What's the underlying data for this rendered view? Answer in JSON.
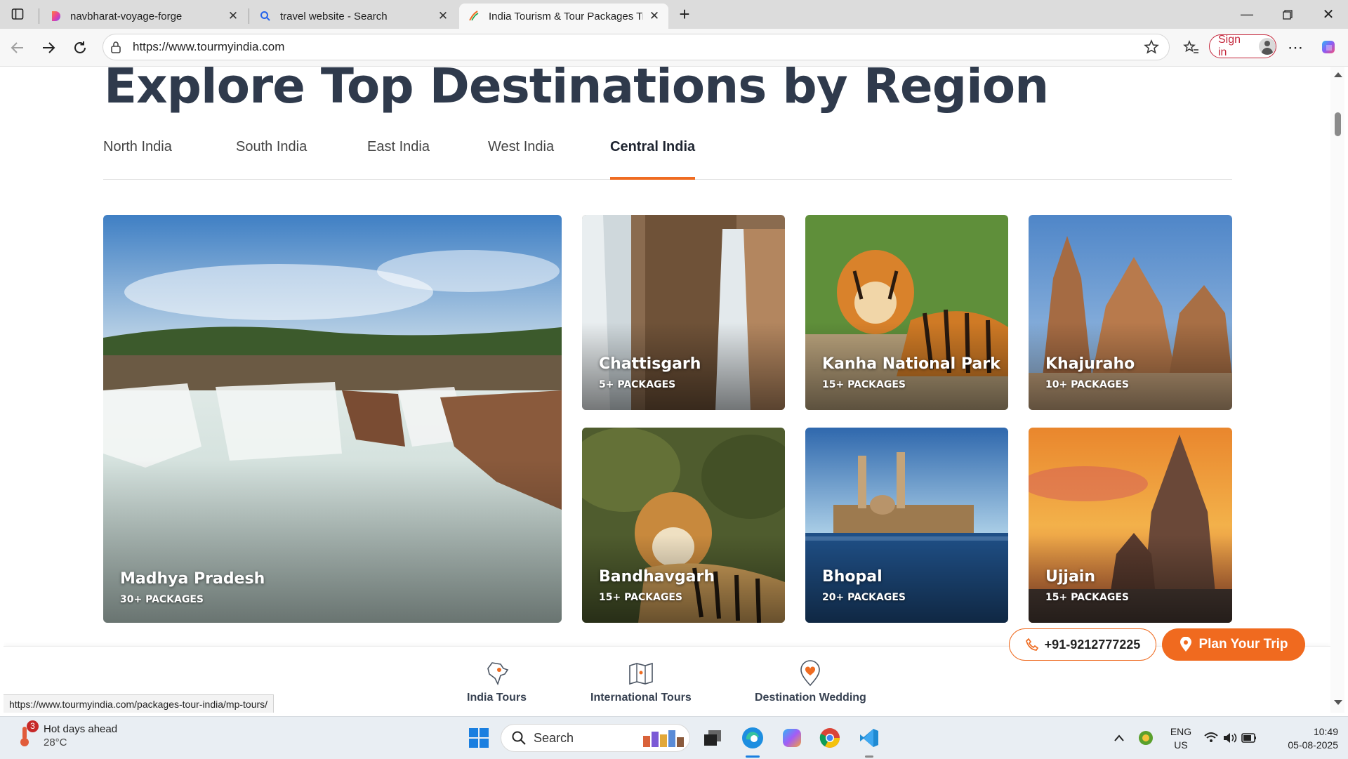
{
  "browser": {
    "tabs": [
      {
        "title": "navbharat-voyage-forge",
        "icon": "lovable-icon",
        "active": false
      },
      {
        "title": "travel website - Search",
        "icon": "search-icon",
        "active": false
      },
      {
        "title": "India Tourism & Tour Packages Tr",
        "icon": "tourmyindia-icon",
        "active": true
      }
    ],
    "url": "https://www.tourmyindia.com",
    "sign_in_label": "Sign in",
    "status_url": "https://www.tourmyindia.com/packages-tour-india/mp-tours/"
  },
  "page": {
    "heading": "Explore Top Destinations by Region",
    "region_tabs": [
      "North India",
      "South India",
      "East India",
      "West India",
      "Central India"
    ],
    "active_region": "Central India",
    "destinations": [
      {
        "name": "Madhya Pradesh",
        "packages": "30+ PACKAGES"
      },
      {
        "name": "Chattisgarh",
        "packages": "5+ PACKAGES"
      },
      {
        "name": "Kanha National Park",
        "packages": "15+ PACKAGES"
      },
      {
        "name": "Khajuraho",
        "packages": "10+ PACKAGES"
      },
      {
        "name": "Bandhavgarh",
        "packages": "15+ PACKAGES"
      },
      {
        "name": "Bhopal",
        "packages": "20+ PACKAGES"
      },
      {
        "name": "Ujjain",
        "packages": "15+ PACKAGES"
      }
    ],
    "footer_nav": [
      {
        "label": "India Tours",
        "icon": "india-map-icon"
      },
      {
        "label": "International Tours",
        "icon": "world-map-icon"
      },
      {
        "label": "Destination Wedding",
        "icon": "heart-pin-icon"
      }
    ],
    "phone": "+91-9212777225",
    "plan_trip_label": "Plan Your Trip",
    "accent_color": "#ef6c22"
  },
  "taskbar": {
    "weather_badge": "3",
    "weather_title": "Hot days ahead",
    "weather_temp": "28°C",
    "search_label": "Search",
    "lang_top": "ENG",
    "lang_bottom": "US",
    "time": "10:49",
    "date": "05-08-2025"
  }
}
